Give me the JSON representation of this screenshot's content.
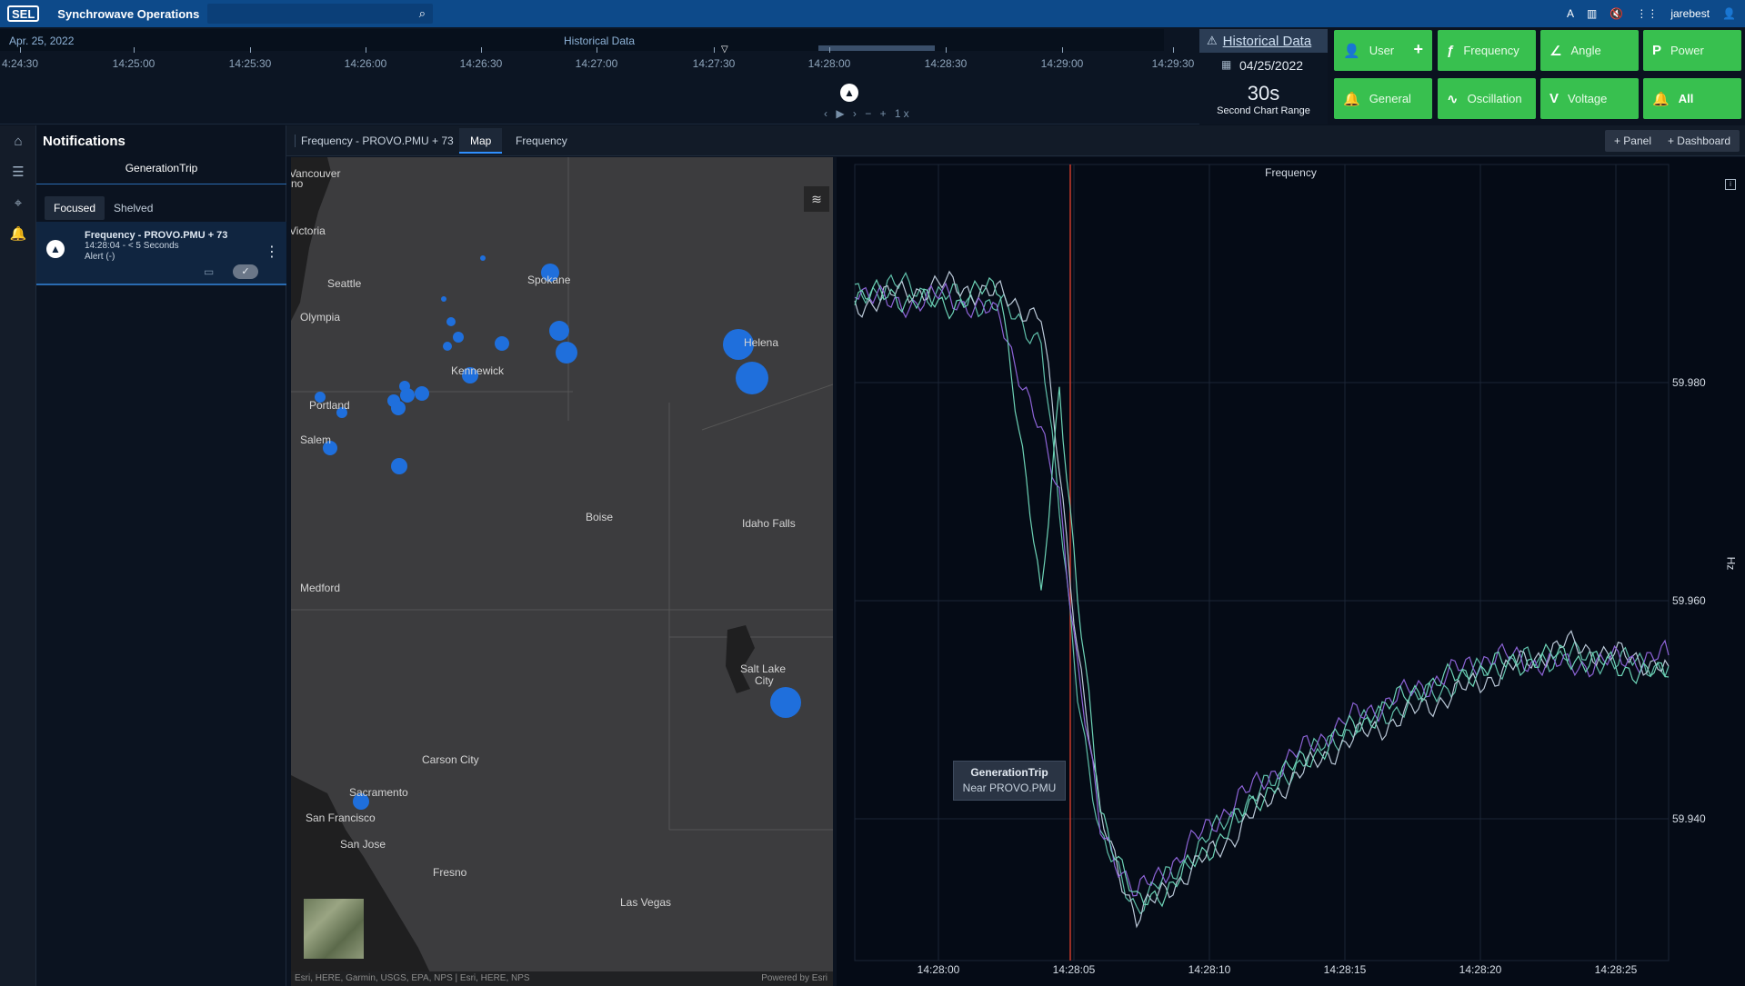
{
  "app": {
    "logo": "SEL",
    "title": "Synchrowave Operations",
    "user": "jarebest",
    "lang": "A"
  },
  "timeline": {
    "date": "Apr. 25, 2022",
    "mode_label": "Historical Data",
    "ticks": [
      "4:24:30",
      "14:25:00",
      "14:25:30",
      "14:26:00",
      "14:26:30",
      "14:27:00",
      "14:27:30",
      "14:28:00",
      "14:28:30",
      "14:29:00",
      "14:29:30"
    ],
    "speed": "1x"
  },
  "historical": {
    "title": "Historical Data",
    "date": "04/25/2022",
    "range": "30s",
    "range_label": "Second Chart Range"
  },
  "filters": [
    {
      "icon": "👤",
      "label": "User",
      "plus": "+"
    },
    {
      "icon": "ƒ",
      "label": "Frequency"
    },
    {
      "icon": "∠",
      "label": "Angle"
    },
    {
      "icon": "P",
      "label": "Power"
    },
    {
      "icon": "🔔",
      "label": "General"
    },
    {
      "icon": "∿",
      "label": "Oscillation"
    },
    {
      "icon": "V",
      "label": "Voltage"
    },
    {
      "icon": "🔔",
      "label": "All"
    }
  ],
  "notifications": {
    "title": "Notifications",
    "subtitle": "GenerationTrip",
    "tabs": [
      "Focused",
      "Shelved"
    ],
    "card": {
      "title": "Frequency - PROVO.PMU + 73",
      "time": "14:28:04 - < 5 Seconds",
      "status": "Alert (-)"
    }
  },
  "panel": {
    "title": "Frequency - PROVO.PMU + 73",
    "tabs": [
      "Map",
      "Frequency"
    ],
    "buttons": [
      "Panel",
      "Dashboard"
    ]
  },
  "map": {
    "labels": [
      "Vancouver",
      "no",
      "Victoria",
      "Seattle",
      "Olympia",
      "Spokane",
      "Helena",
      "Kennewick",
      "Portland",
      "Salem",
      "Boise",
      "Idaho Falls",
      "Medford",
      "Salt Lake",
      "City",
      "Carson City",
      "Sacramento",
      "San Francisco",
      "San Jose",
      "Fresno",
      "Las Vegas"
    ],
    "attribution": "Esri, HERE, Garmin, USGS, EPA, NPS | Esri, HERE, NPS",
    "powered": "Powered by Esri"
  },
  "chart_data": {
    "type": "line",
    "title": "Frequency",
    "ylabel": "Hz",
    "x_ticks": [
      "14:28:00",
      "14:28:05",
      "14:28:10",
      "14:28:15",
      "14:28:20",
      "14:28:25"
    ],
    "y_ticks": [
      59.98,
      59.96,
      59.94
    ],
    "ylim": [
      59.927,
      60.0
    ],
    "event_time": "14:28:05",
    "series": [
      {
        "values": [
          59.988,
          59.989,
          59.988,
          59.987,
          59.984,
          59.968,
          59.952,
          59.938,
          59.932,
          59.935,
          59.94,
          59.944,
          59.948,
          59.951,
          59.954,
          59.955,
          59.954
        ]
      },
      {
        "values": [
          59.987,
          59.988,
          59.989,
          59.988,
          59.986,
          59.972,
          59.956,
          59.94,
          59.931,
          59.934,
          59.938,
          59.943,
          59.947,
          59.95,
          59.953,
          59.956,
          59.954
        ]
      },
      {
        "values": [
          59.989,
          59.987,
          59.988,
          59.986,
          59.975,
          59.97,
          59.954,
          59.939,
          59.933,
          59.936,
          59.941,
          59.945,
          59.949,
          59.952,
          59.955,
          59.954,
          59.955
        ]
      },
      {
        "values": [
          59.988,
          59.988,
          59.987,
          59.989,
          59.96,
          59.98,
          59.96,
          59.941,
          59.932,
          59.934,
          59.939,
          59.944,
          59.948,
          59.952,
          59.954,
          59.955,
          59.953
        ]
      }
    ],
    "series_colors": [
      "#5fbfa9",
      "#b9c7d6",
      "#8c63d6",
      "#6dd3b6"
    ],
    "tooltip": {
      "title": "GenerationTrip",
      "text": "Near PROVO.PMU"
    }
  }
}
